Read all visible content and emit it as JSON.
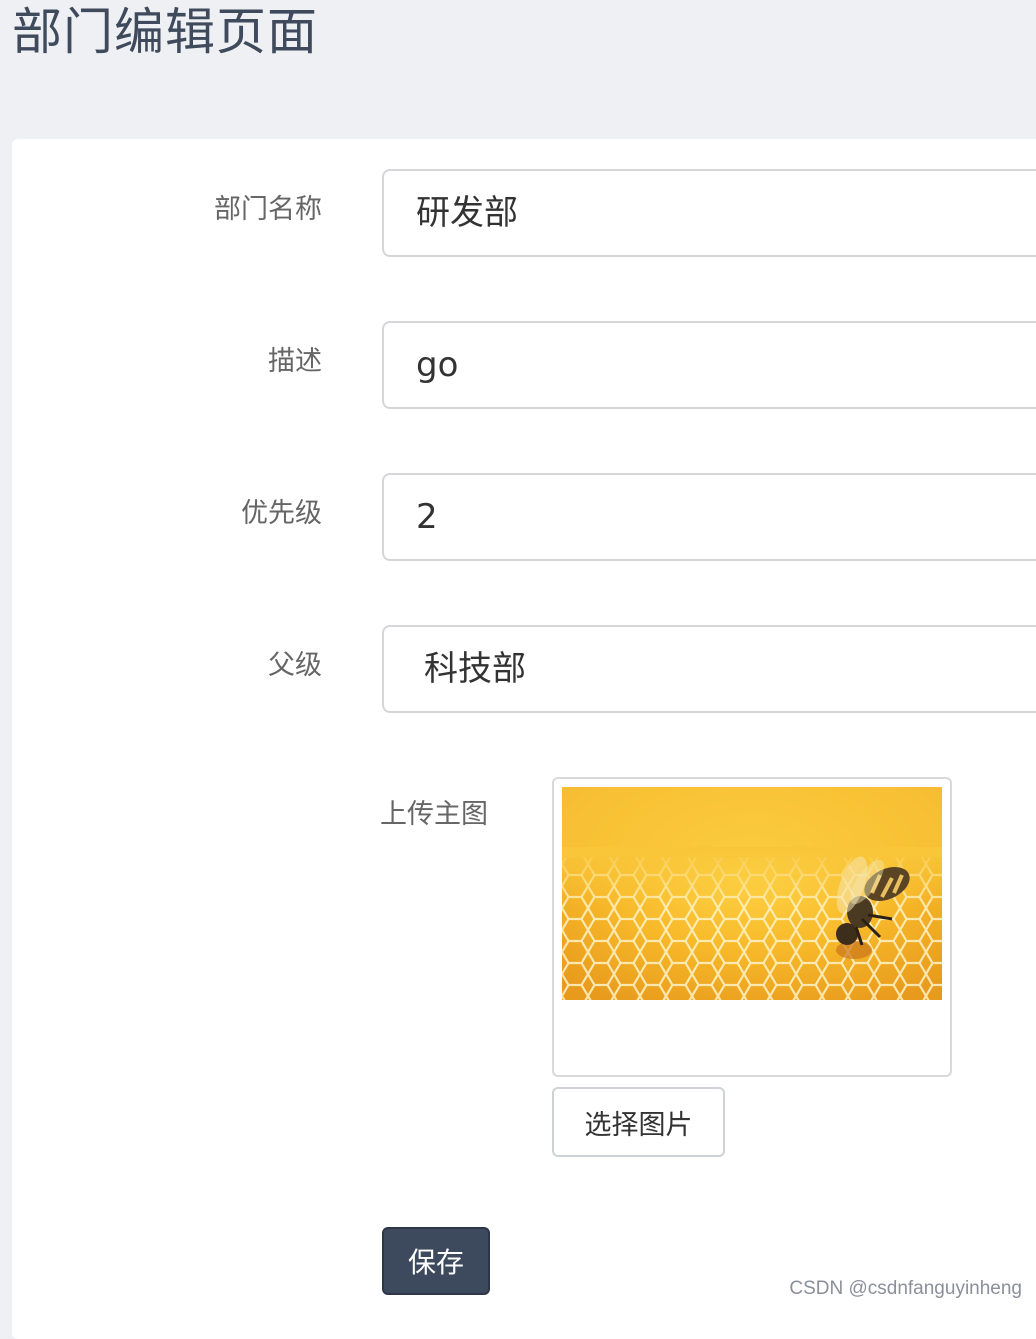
{
  "page": {
    "title": "部门编辑页面"
  },
  "form": {
    "name": {
      "label": "部门名称",
      "value": "研发部"
    },
    "description": {
      "label": "描述",
      "value": "go"
    },
    "priority": {
      "label": "优先级",
      "value": "2"
    },
    "parent": {
      "label": "父级",
      "value": "科技部"
    },
    "upload": {
      "label": "上传主图",
      "choose_label": "选择图片"
    },
    "save_label": "保存"
  },
  "watermark": "CSDN @csdnfanguyinheng",
  "colors": {
    "background": "#eef0f4",
    "primary_button": "#3d4a5e",
    "title": "#3f4a5c"
  }
}
